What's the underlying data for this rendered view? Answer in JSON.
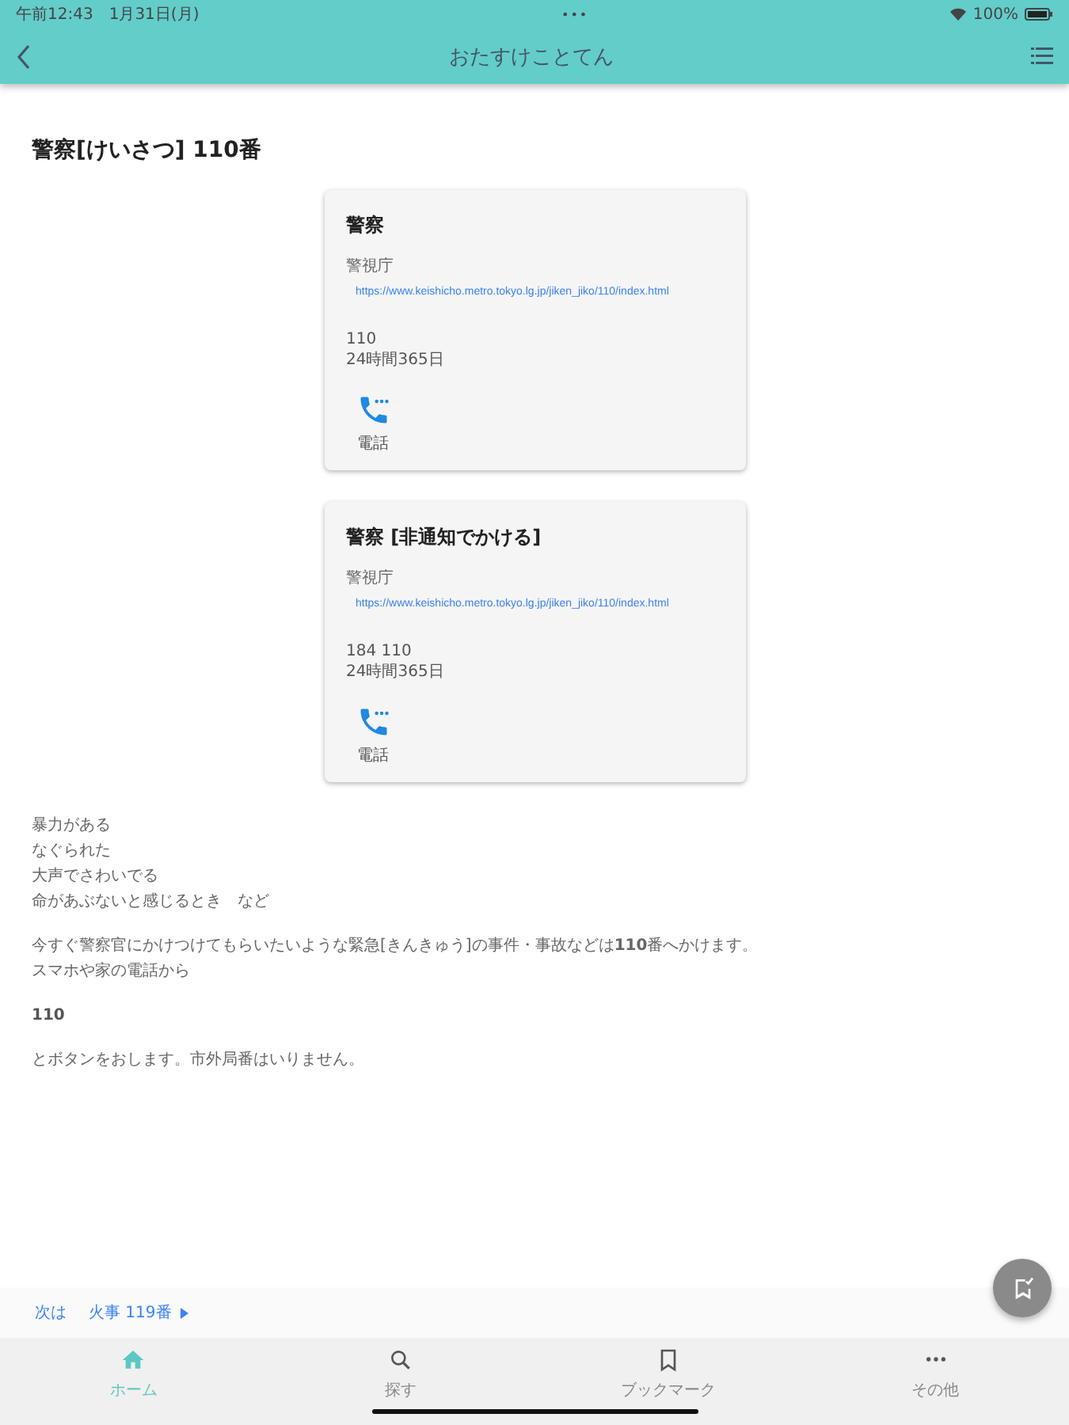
{
  "status_bar": {
    "time": "午前12:43",
    "date": "1月31日(月)",
    "dots": "•••",
    "battery": "100%"
  },
  "nav": {
    "title": "おたすけことてん"
  },
  "heading": "警察[けいさつ] 110番",
  "cards": [
    {
      "title": "警察",
      "org": "警視庁",
      "url": "https://www.keishicho.metro.tokyo.lg.jp/jiken_jiko/110/index.html",
      "number": "110",
      "hours": "24時間365日",
      "action": "電話"
    },
    {
      "title": "警察 [非通知でかける]",
      "org": "警視庁",
      "url": "https://www.keishicho.metro.tokyo.lg.jp/jiken_jiko/110/index.html",
      "number": "184 110",
      "hours": "24時間365日",
      "action": "電話"
    }
  ],
  "body": [
    {
      "bold": false,
      "lines": [
        "暴力がある",
        "なぐられた",
        "大声でさわいでる",
        "命があぶないと感じるとき　など"
      ]
    },
    {
      "bold": false,
      "lines": [
        "今すぐ警察官にかけつけてもらいたいような緊急[きんきゅう]の事件・事故などは**110**番へかけます。",
        "スマホや家の電話から"
      ]
    },
    {
      "bold": true,
      "lines": [
        "110"
      ]
    },
    {
      "bold": false,
      "lines": [
        "とボタンをおします。市外局番はいりません。"
      ]
    }
  ],
  "next_link": {
    "prefix": "次は",
    "label": "火事 119番"
  },
  "tabs": [
    {
      "kind": "home",
      "label": "ホーム",
      "selected": true
    },
    {
      "kind": "search",
      "label": "探す",
      "selected": false
    },
    {
      "kind": "bookmark",
      "label": "ブックマーク",
      "selected": false
    },
    {
      "kind": "more",
      "label": "その他",
      "selected": false
    }
  ]
}
